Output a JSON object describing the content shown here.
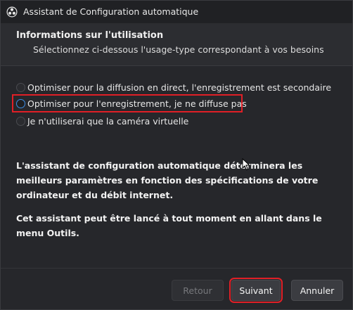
{
  "window": {
    "title": "Assistant de Configuration automatique",
    "app_icon": "obs-icon"
  },
  "header": {
    "title": "Informations sur l'utilisation",
    "subtitle": "Sélectionnez ci-dessous l'usage-type correspondant à vos besoins"
  },
  "options": [
    {
      "label": "Optimiser pour la diffusion en direct, l'enregistrement est secondaire",
      "selected": false
    },
    {
      "label": "Optimiser pour l'enregistrement, je ne diffuse pas",
      "selected": true
    },
    {
      "label": "Je n'utiliserai que la caméra virtuelle",
      "selected": false
    }
  ],
  "description": {
    "paragraph1": "L'assistant de configuration automatique déterminera les meilleurs paramètres en fonction des spécifications de votre ordinateur et du débit internet.",
    "paragraph2": "Cet assistant peut être lancé à tout moment en allant dans le menu Outils."
  },
  "buttons": {
    "back": "Retour",
    "next": "Suivant",
    "cancel": "Annuler",
    "back_enabled": false
  },
  "colors": {
    "background": "#26272b",
    "header_bg": "#2c2d31",
    "accent": "#3d8ee6",
    "highlight": "#e01f26"
  }
}
